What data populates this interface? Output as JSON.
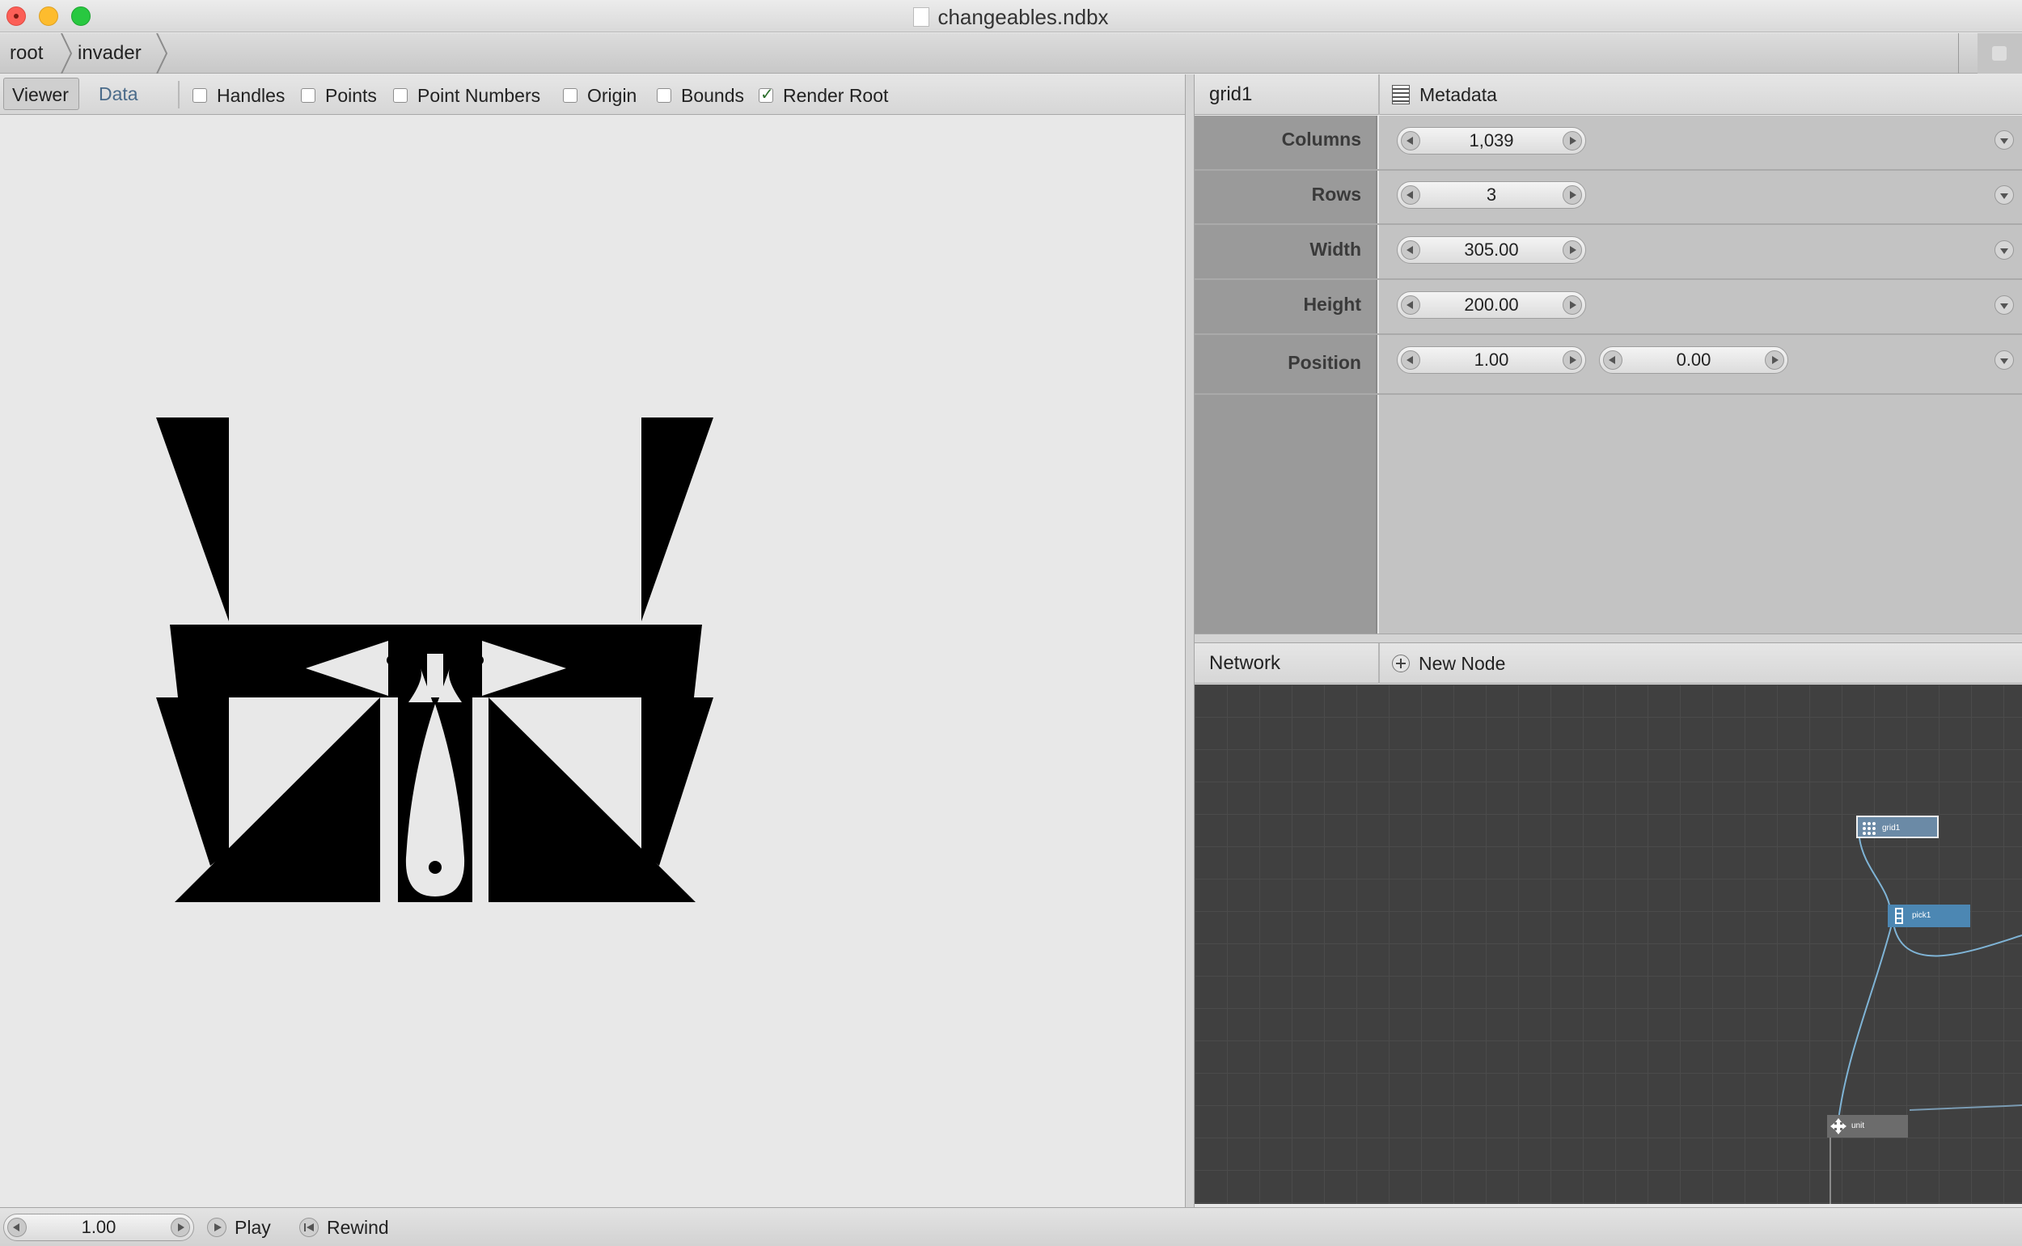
{
  "window": {
    "title": "changeables.ndbx"
  },
  "breadcrumb": {
    "items": [
      "root",
      "invader"
    ]
  },
  "viewer_toolbar": {
    "tabs": [
      {
        "label": "Viewer",
        "active": true
      },
      {
        "label": "Data",
        "active": false
      }
    ],
    "checkboxes": [
      {
        "label": "Handles",
        "checked": false
      },
      {
        "label": "Points",
        "checked": false
      },
      {
        "label": "Point Numbers",
        "checked": false
      },
      {
        "label": "Origin",
        "checked": false
      },
      {
        "label": "Bounds",
        "checked": false
      },
      {
        "label": "Render Root",
        "checked": true
      }
    ]
  },
  "parameters": {
    "node_name": "grid1",
    "metadata_label": "Metadata",
    "rows": [
      {
        "label": "Columns",
        "values": [
          "1,039"
        ]
      },
      {
        "label": "Rows",
        "values": [
          "3"
        ]
      },
      {
        "label": "Width",
        "values": [
          "305.00"
        ]
      },
      {
        "label": "Height",
        "values": [
          "200.00"
        ]
      },
      {
        "label": "Position",
        "values": [
          "1.00",
          "0.00"
        ]
      }
    ]
  },
  "network": {
    "title": "Network",
    "new_node_label": "New Node",
    "nodes": [
      {
        "id": "grid1",
        "label": "grid1",
        "icon": "grid-icon",
        "selected": true,
        "color": "#6b8aa6"
      },
      {
        "id": "pick1",
        "label": "pick1",
        "icon": "pick-icon",
        "selected": false,
        "color": "#4c87b3"
      },
      {
        "id": "unit",
        "label": "unit",
        "icon": "move-icon",
        "selected": false,
        "color": "#6c6c6c"
      }
    ]
  },
  "playback": {
    "frame": "1.00",
    "play_label": "Play",
    "rewind_label": "Rewind"
  },
  "colors": {
    "canvas_bg": "#e8e8e8",
    "network_bg": "#404040",
    "shape_fill": "#000000"
  }
}
